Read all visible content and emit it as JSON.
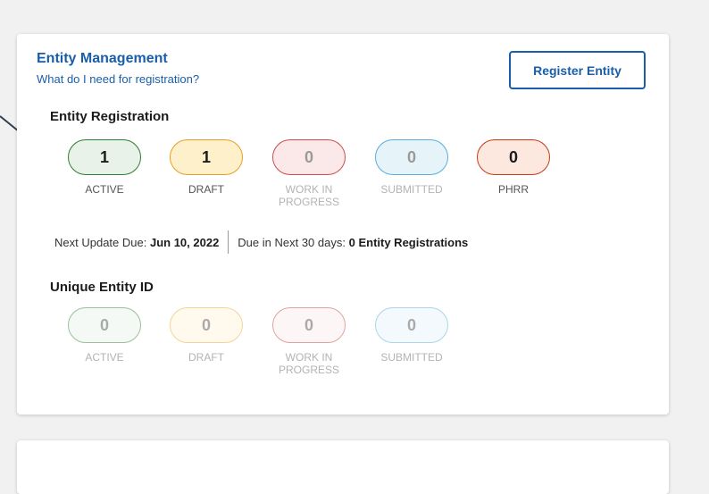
{
  "entity_management": {
    "title": "Entity Management",
    "help_link": "What do I need for registration?",
    "register_button": "Register Entity"
  },
  "entity_registration": {
    "heading": "Entity Registration",
    "stats": [
      {
        "value": "1",
        "label": "ACTIVE"
      },
      {
        "value": "1",
        "label": "DRAFT"
      },
      {
        "value": "0",
        "label": "WORK IN PROGRESS"
      },
      {
        "value": "0",
        "label": "SUBMITTED"
      },
      {
        "value": "0",
        "label": "PHRR"
      }
    ],
    "next_update_label": "Next Update Due:",
    "next_update_date": "Jun 10, 2022",
    "due_label": "Due in Next 30 days:",
    "due_value": "0 Entity Registrations"
  },
  "unique_entity_id": {
    "heading": "Unique Entity ID",
    "stats": [
      {
        "value": "0",
        "label": "ACTIVE"
      },
      {
        "value": "0",
        "label": "DRAFT"
      },
      {
        "value": "0",
        "label": "WORK IN PROGRESS"
      },
      {
        "value": "0",
        "label": "SUBMITTED"
      }
    ]
  },
  "colors": {
    "link_blue": "#1a5ea8",
    "active": "#2e7d32",
    "draft": "#e6a020",
    "work_in_progress": "#cc4b4b",
    "submitted": "#5aaed6",
    "phrr": "#c83a12"
  }
}
